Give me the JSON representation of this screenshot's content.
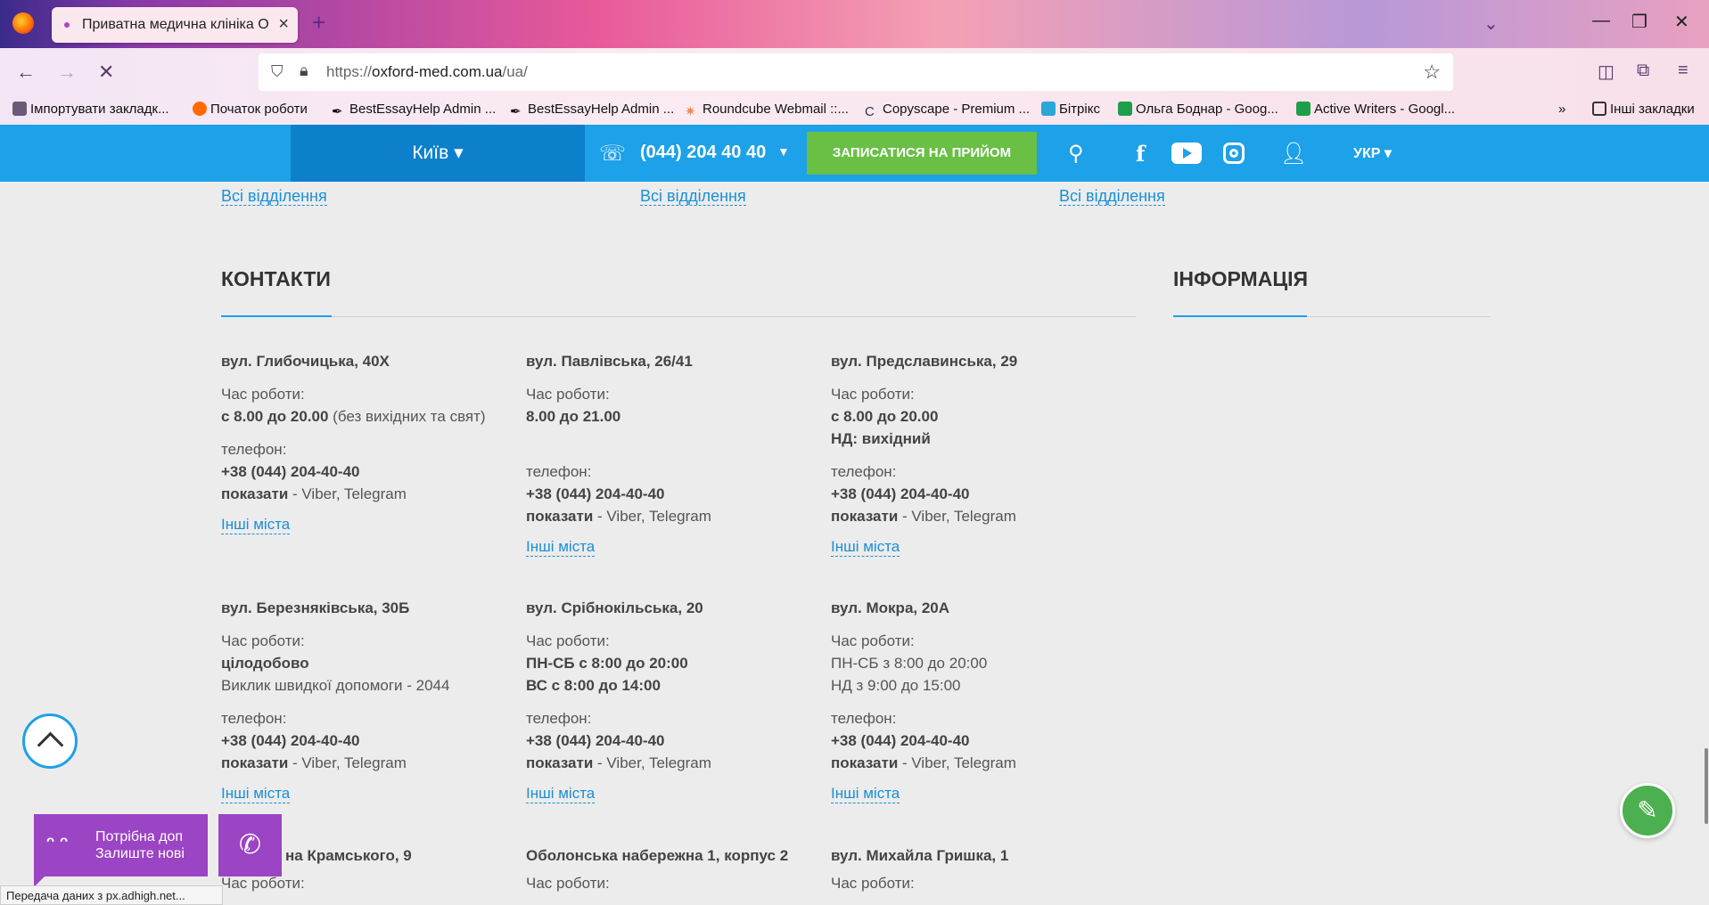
{
  "browser": {
    "tab_title": "Приватна медична клініка Oxfo",
    "url_prefix": "https://",
    "url_domain": "oxford-med.com.ua",
    "url_path": "/ua/",
    "bookmarks": [
      "Імпортувати закладк...",
      "Початок роботи",
      "BestEssayHelp Admin ...",
      "BestEssayHelp Admin ...",
      "Roundcube Webmail ::...",
      "Copyscape - Premium ...",
      "Бітрікс",
      "Ольга Боднар - Goog...",
      "Active Writers - Googl..."
    ],
    "other_bookmarks": "Інші закладки",
    "status_text": "Передача даних з px.adhigh.net..."
  },
  "header": {
    "city": "Київ ▾",
    "phone": "(044) 204 40 40",
    "book_button": "ЗАПИСАТИСЯ НА ПРИЙОМ",
    "language": "УКР ▾"
  },
  "all_departments_label": "Всі відділення",
  "sections": {
    "contacts_title": "КОНТАКТИ",
    "info_title": "ІНФОРМАЦІЯ"
  },
  "labels": {
    "hours": "Час роботи:",
    "phone": "телефон:",
    "show": "показати",
    "messengers": " - Viber, Telegram",
    "other_cities": "Інші міста"
  },
  "locations": [
    {
      "street": "вул. Глибочицька, 40Х",
      "hours_bold": "с 8.00 до 20.00",
      "hours_extra": " (без вихідних та свят)",
      "hours2": "",
      "phone": "+38 (044) 204-40-40"
    },
    {
      "street": "вул. Павлівська, 26/41",
      "hours_bold": "8.00 до 21.00",
      "hours_extra": "",
      "hours2": "",
      "phone": "+38 (044) 204-40-40"
    },
    {
      "street": "вул. Предславинська, 29",
      "hours_bold": "с 8.00 до 20.00",
      "hours_extra": "",
      "hours2": "НД: вихідний",
      "phone": "+38 (044) 204-40-40"
    },
    {
      "street": "вул. Березняківська, 30Б",
      "hours_bold": "цілодобово",
      "hours_extra": "",
      "hours2": "Виклик швидкої допомоги - 2044",
      "phone": "+38 (044) 204-40-40"
    },
    {
      "street": "вул. Срібнокільська, 20",
      "hours_bold": "ПН-СБ с 8:00 до 20:00",
      "hours_extra": "",
      "hours2": "ВС с 8:00 до 14:00",
      "phone": "+38 (044) 204-40-40"
    },
    {
      "street": "вул. Мокра, 20А",
      "hours_bold": "ПН-СБ з 8:00 до 20:00",
      "hours_extra": "",
      "hours2": "НД з 9:00 до 15:00",
      "phone": "+38 (044) 204-40-40"
    },
    {
      "street": "на Крамського, 9",
      "hours_bold": "",
      "hours_extra": "",
      "hours2": "",
      "phone": ""
    },
    {
      "street": "Оболонська набережна 1, корпус 2",
      "hours_bold": "",
      "hours_extra": "",
      "hours2": "",
      "phone": ""
    },
    {
      "street": "вул. Михайла Гришка, 1",
      "hours_bold": "",
      "hours_extra": "",
      "hours2": "",
      "phone": ""
    }
  ],
  "widgets": {
    "help_line1": "Потрібна доп",
    "help_line2": "Залиште нові"
  }
}
